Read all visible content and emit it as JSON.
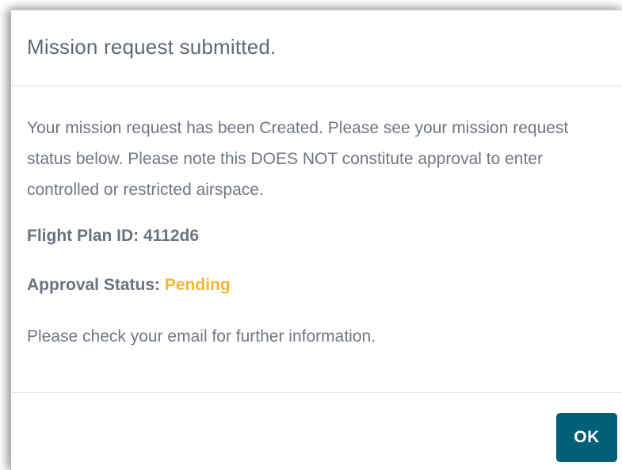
{
  "dialog": {
    "title": "Mission request submitted.",
    "message": "Your mission request has been Created. Please see your mission request status below. Please note this DOES NOT constitute approval to enter controlled or restricted airspace.",
    "flight_plan_label": "Flight Plan ID:",
    "flight_plan_id": "4112d6",
    "approval_status_label": "Approval Status:",
    "approval_status_value": "Pending",
    "note": "Please check your email for further information.",
    "ok_label": "OK"
  },
  "colors": {
    "title": "#5f6a77",
    "body_text": "#6f7783",
    "pending_status": "#f2b632",
    "button_bg": "#005e76",
    "button_text": "#ffffff",
    "divider": "#dcdfe8"
  }
}
